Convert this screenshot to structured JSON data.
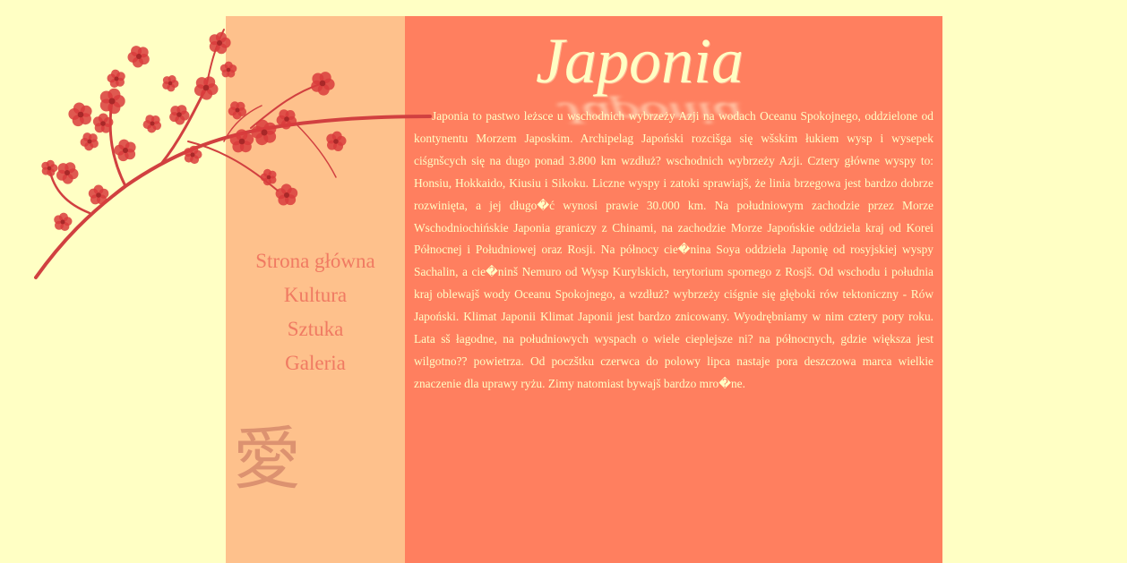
{
  "header": {
    "title": "Japonia"
  },
  "nav": {
    "items": [
      "Strona główna",
      "Kultura",
      "Sztuka",
      "Galeria"
    ]
  },
  "decoration": {
    "kanji": "愛",
    "branch_icon": "cherry-blossom-branch",
    "flower_color": "#d93c3c"
  },
  "content": {
    "text": "Japonia to pastwo leżsce u wschodnich wybrzeży Azji na wodach Oceanu Spokojnego, oddzielone od kontynentu Morzem Japoskim. Archipelag Japoński rozcišga się wšskim łukiem wysp i wysepek ciśgnšcych się na dugo ponad 3.800 km wzdłuż? wschodnich wybrzeży Azji. Cztery główne wyspy to: Honsiu, Hokkaido, Kiusiu i Sikoku. Liczne wyspy i zatoki sprawiajš, że linia brzegowa jest bardzo dobrze rozwinięta, a jej długo�ć wynosi prawie 30.000 km. Na południowym zachodzie przez Morze Wschodniochińskie Japonia graniczy z Chinami, na zachodzie Morze Japońskie oddziela kraj od Korei Północnej i Południowej oraz Rosji. Na północy cie�nina Soya oddziela Japonię od rosyjskiej wyspy Sachalin, a cie�ninš Nemuro od Wysp Kurylskich, terytorium spornego z Rosjš. Od wschodu i południa kraj oblewajš wody Oceanu Spokojnego, a wzdłuż? wybrzeży ciśgnie się głęboki rów tektoniczny - Rów Japoński. Klimat Japonii Klimat Japonii jest bardzo znicowany. Wyodrębniamy w nim cztery pory roku. Lata sš łagodne, na południowych wyspach o wiele cieplejsze ni? na północnych, gdzie większa jest wilgotno?? powietrza. Od poczštku czerwca do polowy lipca nastaje pora deszczowa marca wielkie znaczenie dla uprawy ryżu. Zimy natomiast bywajš bardzo mro�ne."
  },
  "colors": {
    "page_background": "#ffffc4",
    "sidebar_background": "#fec18c",
    "main_background": "#ff7f5f",
    "nav_text": "#f07a62",
    "content_text": "#fffec4"
  }
}
